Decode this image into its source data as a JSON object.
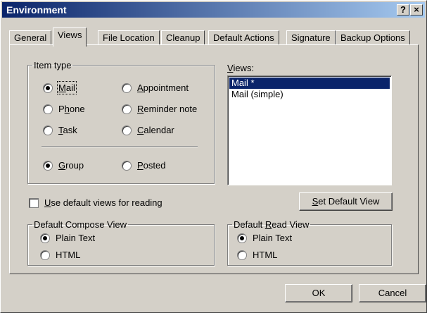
{
  "window": {
    "title": "Environment",
    "help_label": "?",
    "close_label": "×"
  },
  "tabs": [
    "General",
    "Views",
    "File Location",
    "Cleanup",
    "Default Actions",
    "Signature",
    "Backup Options"
  ],
  "item_type": {
    "legend": "Item type",
    "options": [
      {
        "label_pre": "",
        "key": "M",
        "label_post": "ail",
        "selected": true
      },
      {
        "label_pre": "",
        "key": "A",
        "label_post": "ppointment",
        "selected": false
      },
      {
        "label_pre": "P",
        "key": "h",
        "label_post": "one",
        "selected": false
      },
      {
        "label_pre": "",
        "key": "R",
        "label_post": "eminder note",
        "selected": false
      },
      {
        "label_pre": "",
        "key": "T",
        "label_post": "ask",
        "selected": false
      },
      {
        "label_pre": "",
        "key": "C",
        "label_post": "alendar",
        "selected": false
      }
    ],
    "group_options": [
      {
        "label_pre": "",
        "key": "G",
        "label_post": "roup",
        "selected": true
      },
      {
        "label_pre": "",
        "key": "P",
        "label_post": "osted",
        "selected": false
      }
    ]
  },
  "views": {
    "label_key": "V",
    "label_rest": "iews:",
    "items": [
      "Mail *",
      "Mail (simple)"
    ],
    "selected_index": 0
  },
  "use_default_views": {
    "key": "U",
    "label_rest": "se default views for reading",
    "checked": false
  },
  "set_default_button": {
    "key": "S",
    "label_rest": "et Default View"
  },
  "compose_view": {
    "legend_pre": "Default Compose View",
    "options": [
      {
        "label": "Plain Text",
        "selected": true
      },
      {
        "label": "HTML",
        "selected": false
      }
    ]
  },
  "read_view": {
    "legend_pre": "Default ",
    "legend_key": "R",
    "legend_post": "ead View",
    "options": [
      {
        "label": "Plain Text",
        "selected": true
      },
      {
        "label": "HTML",
        "selected": false
      }
    ]
  },
  "buttons": {
    "ok": "OK",
    "cancel": "Cancel"
  }
}
